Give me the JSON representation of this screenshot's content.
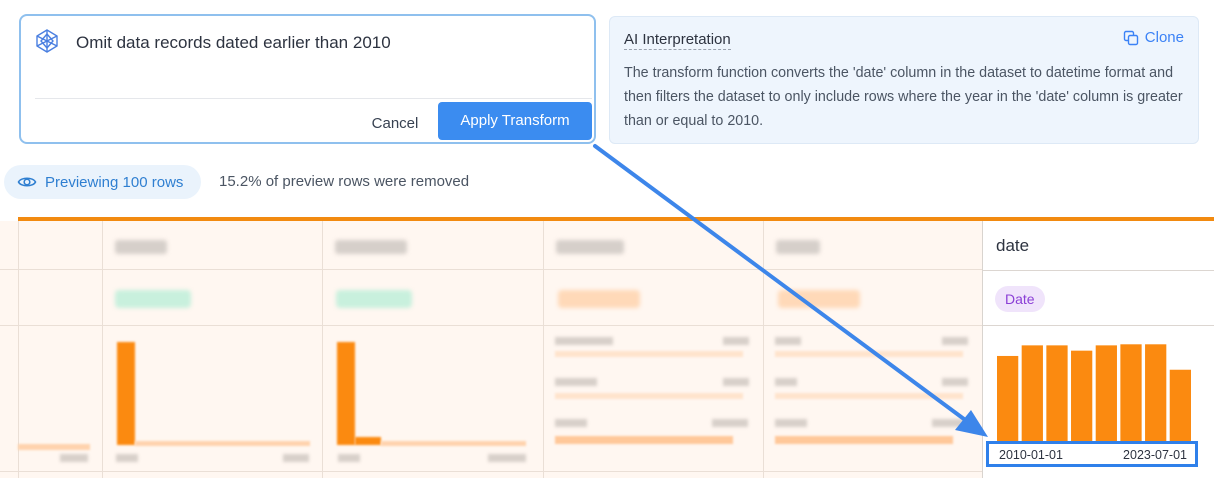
{
  "prompt": {
    "text": "Omit data records dated earlier than 2010",
    "cancel_label": "Cancel",
    "apply_label": "Apply Transform"
  },
  "ai_interpretation": {
    "title": "AI Interpretation",
    "clone_label": "Clone",
    "description": "The transform function converts the 'date' column in the dataset to datetime format and then filters the dataset to only include rows where the year in the 'date' column is greater than or equal to 2010."
  },
  "preview": {
    "label": "Previewing 100 rows",
    "removed_text": "15.2% of preview rows were removed"
  },
  "date_column": {
    "header": "date",
    "type_tag": "Date",
    "range_start": "2010-01-01",
    "range_end": "2023-07-01",
    "histogram_relative_heights": [
      0.84,
      0.94,
      0.94,
      0.89,
      0.94,
      0.95,
      0.95,
      0.71
    ]
  },
  "colors": {
    "accent_blue": "#3b8cf0",
    "orange": "#fb8a10",
    "date_tag_text": "#8b3fd6",
    "date_tag_bg": "#f0e4fb",
    "highlight_border": "#2f80ea"
  }
}
